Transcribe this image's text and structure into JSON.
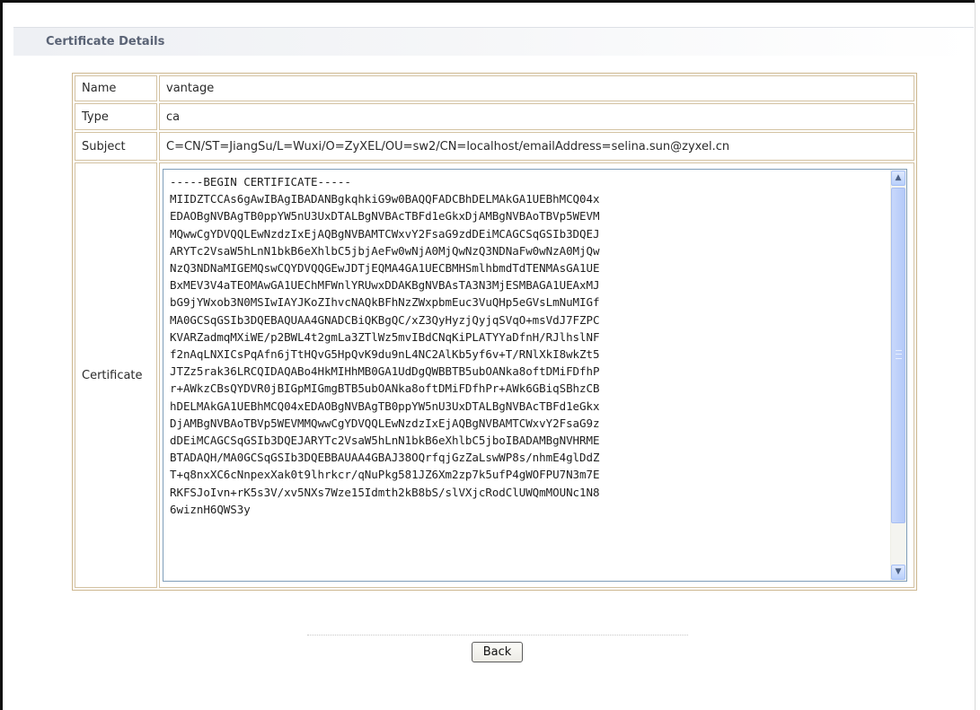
{
  "section": {
    "title": "Certificate Details"
  },
  "rows": [
    {
      "label": "Name",
      "value": "vantage"
    },
    {
      "label": "Type",
      "value": "ca"
    },
    {
      "label": "Subject",
      "value": "C=CN/ST=JiangSu/L=Wuxi/O=ZyXEL/OU=sw2/CN=localhost/emailAddress=selina.sun@zyxel.cn"
    },
    {
      "label": "Certificate"
    }
  ],
  "certificate": {
    "lines": [
      "-----BEGIN CERTIFICATE-----",
      "MIIDZTCCAs6gAwIBAgIBADANBgkqhkiG9w0BAQQFADCBhDELMAkGA1UEBhMCQ04x",
      "EDAOBgNVBAgTB0ppYW5nU3UxDTALBgNVBAcTBFd1eGkxDjAMBgNVBAoTBVp5WEVM",
      "MQwwCgYDVQQLEwNzdzIxEjAQBgNVBAMTCWxvY2FsaG9zdDEiMCAGCSqGSIb3DQEJ",
      "ARYTc2VsaW5hLnN1bkB6eXhlbC5jbjAeFw0wNjA0MjQwNzQ3NDNaFw0wNzA0MjQw",
      "NzQ3NDNaMIGEMQswCQYDVQQGEwJDTjEQMA4GA1UECBMHSmlhbmdTdTENMAsGA1UE",
      "BxMEV3V4aTEOMAwGA1UEChMFWnlYRUwxDDAKBgNVBAsTA3N3MjESMBAGA1UEAxMJ",
      "bG9jYWxob3N0MSIwIAYJKoZIhvcNAQkBFhNzZWxpbmEuc3VuQHp5eGVsLmNuMIGf",
      "MA0GCSqGSIb3DQEBAQUAA4GNADCBiQKBgQC/xZ3QyHyzjQyjqSVqO+msVdJ7FZPC",
      "KVARZadmqMXiWE/p2BWL4t2gmLa3ZTlWz5mvIBdCNqKiPLATYYaDfnH/RJlhslNF",
      "f2nAqLNXICsPqAfn6jTtHQvG5HpQvK9du9nL4NC2AlKb5yf6v+T/RNlXkI8wkZt5",
      "JTZz5rak36LRCQIDAQABo4HkMIHhMB0GA1UdDgQWBBTB5ubOANka8oftDMiFDfhP",
      "r+AWkzCBsQYDVR0jBIGpMIGmgBTB5ubOANka8oftDMiFDfhPr+AWk6GBiqSBhzCB",
      "hDELMAkGA1UEBhMCQ04xEDAOBgNVBAgTB0ppYW5nU3UxDTALBgNVBAcTBFd1eGkx",
      "DjAMBgNVBAoTBVp5WEVMMQwwCgYDVQQLEwNzdzIxEjAQBgNVBAMTCWxvY2FsaG9z",
      "dDEiMCAGCSqGSIb3DQEJARYTc2VsaW5hLnN1bkB6eXhlbC5jboIBADAMBgNVHRME",
      "BTADAQH/MA0GCSqGSIb3DQEBBAUAA4GBAJ38OQrfqjGzZaLswWP8s/nhmE4glDdZ",
      "T+q8nxXC6cNnpexXak0t9lhrkcr/qNuPkg581JZ6Xm2zp7k5ufP4gWOFPU7N3m7E",
      "RKFSJoIvn+rK5s3V/xv5NXs7Wze15Idmth2kB8bS/slVXjcRodClUWQmMOUNc1N8",
      "6wiznH6QWS3y"
    ]
  },
  "scrollbar": {
    "up_icon": "arrow-up-icon",
    "down_icon": "arrow-down-icon"
  },
  "actions": {
    "back_label": "Back"
  }
}
